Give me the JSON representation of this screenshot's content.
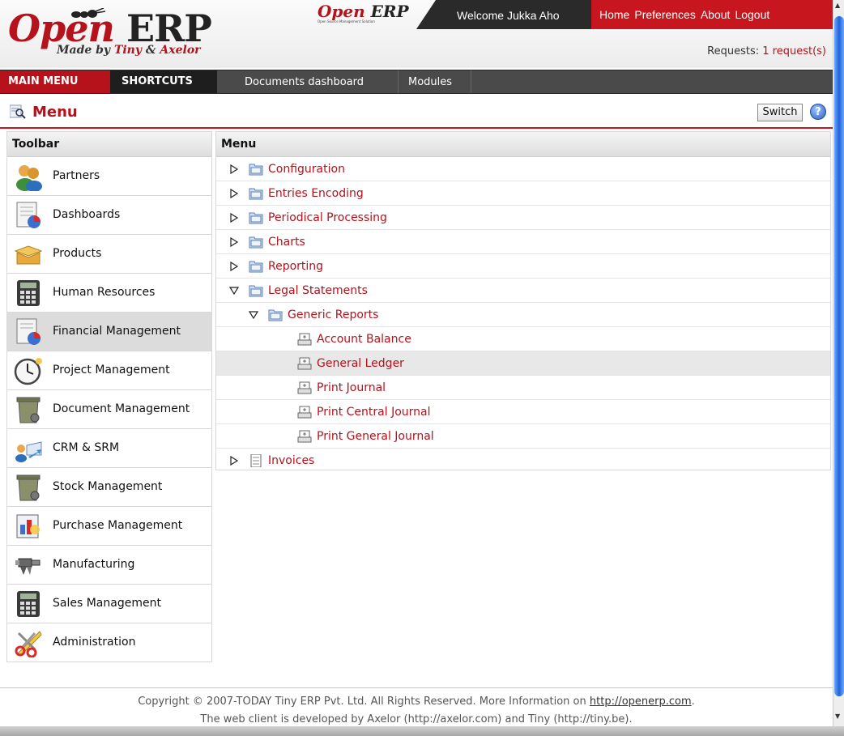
{
  "header": {
    "logo_open": "Open",
    "logo_erp": "ERP",
    "logo_made_by": "Made by",
    "logo_tiny": "Tiny",
    "logo_and": "&",
    "logo_axelor": "Axelor",
    "mini_logo_open": "Open",
    "mini_logo_erp": " ERP",
    "mini_logo_tagline": "Open Source Management Solution",
    "welcome": "Welcome Jukka Aho",
    "nav": [
      "Home",
      "Preferences",
      "About",
      "Logout"
    ],
    "requests_label": "Requests:",
    "requests_link": "1 request(s)"
  },
  "menubar": {
    "main_menu": "MAIN MENU",
    "shortcuts": "SHORTCUTS",
    "links": [
      "Documents dashboard",
      "Modules"
    ]
  },
  "title": {
    "text": "Menu",
    "switch": "Switch",
    "help": "?"
  },
  "toolbar": {
    "heading": "Toolbar",
    "items": [
      {
        "label": "Partners",
        "icon": "partners-icon"
      },
      {
        "label": "Dashboards",
        "icon": "dashboards-icon"
      },
      {
        "label": "Products",
        "icon": "products-icon"
      },
      {
        "label": "Human Resources",
        "icon": "calculator-icon"
      },
      {
        "label": "Financial Management",
        "icon": "financial-icon"
      },
      {
        "label": "Project Management",
        "icon": "clock-icon"
      },
      {
        "label": "Document Management",
        "icon": "trash-box-icon"
      },
      {
        "label": "CRM & SRM",
        "icon": "crm-icon"
      },
      {
        "label": "Stock Management",
        "icon": "stock-box-icon"
      },
      {
        "label": "Purchase Management",
        "icon": "purchase-icon"
      },
      {
        "label": "Manufacturing",
        "icon": "manufacturing-icon"
      },
      {
        "label": "Sales Management",
        "icon": "calculator-icon"
      },
      {
        "label": "Administration",
        "icon": "scissors-icon"
      }
    ]
  },
  "menu": {
    "heading": "Menu",
    "items": [
      {
        "label": "Configuration",
        "expanded": false,
        "level": 0,
        "kind": "folder"
      },
      {
        "label": "Entries Encoding",
        "expanded": false,
        "level": 0,
        "kind": "folder"
      },
      {
        "label": "Periodical Processing",
        "expanded": false,
        "level": 0,
        "kind": "folder"
      },
      {
        "label": "Charts",
        "expanded": false,
        "level": 0,
        "kind": "folder"
      },
      {
        "label": "Reporting",
        "expanded": false,
        "level": 0,
        "kind": "folder"
      },
      {
        "label": "Legal Statements",
        "expanded": true,
        "level": 0,
        "kind": "folder"
      },
      {
        "label": "Generic Reports",
        "expanded": true,
        "level": 1,
        "kind": "folder"
      },
      {
        "label": "Account Balance",
        "level": 2,
        "kind": "print"
      },
      {
        "label": "General Ledger",
        "level": 2,
        "kind": "print"
      },
      {
        "label": "Print Journal",
        "level": 2,
        "kind": "print"
      },
      {
        "label": "Print Central Journal",
        "level": 2,
        "kind": "print"
      },
      {
        "label": "Print General Journal",
        "level": 2,
        "kind": "print"
      },
      {
        "label": "Invoices",
        "expanded": false,
        "level": 0,
        "kind": "doc"
      }
    ]
  },
  "footer": {
    "line1_prefix": "Copyright © 2007-TODAY Tiny ERP Pvt. Ltd. All Rights Reserved. More Information on",
    "line1_link": "http://openerp.com",
    "line1_suffix": ".",
    "line2": "The web client is developed by Axelor (http://axelor.com) and Tiny (http://tiny.be)."
  },
  "colors": {
    "brand_red": "#b5121b",
    "menubar_dark": "#4a4a4a",
    "selected_row": "#dcdcdc"
  }
}
